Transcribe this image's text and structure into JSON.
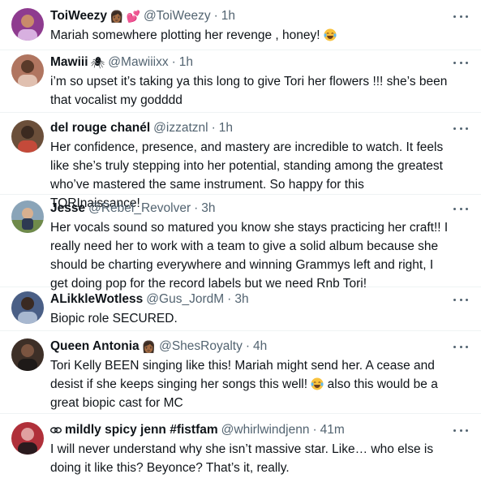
{
  "tweets": [
    {
      "name": "ToiWeezy",
      "emojis": [
        "👩🏾",
        "💕"
      ],
      "handle": "@ToiWeezy",
      "separator": "·",
      "time": "1h",
      "text": "Mariah somewhere plotting her revenge , honey!",
      "avatar_color": "#8e3b8f"
    },
    {
      "name": "Mawiii",
      "emojis": [
        "🕷"
      ],
      "handle": "@Mawiiixx",
      "separator": "·",
      "time": "1h",
      "text": "i’m so upset it’s taking ya this long to give Tori her flowers !!! she’s been that vocalist my godddd",
      "avatar_color": "#b07560"
    },
    {
      "name": "del rouge chanél",
      "handle": "@izzatznl",
      "separator": "·",
      "time": "1h",
      "text": "Her confidence, presence, and mastery are incredible to watch. It feels like she’s truly stepping into her potential, standing among the greatest who’ve mastered the same instrument. So happy for this TORInaissance!",
      "avatar_color": "#6b4f3a"
    },
    {
      "name": "Jesse",
      "handle": "@Rebel_Revolver",
      "separator": "·",
      "time": "3h",
      "text": "Her vocals sound so matured you know she stays practicing her craft!! I really need her to work with a team to give a solid album because she should be charting everywhere and winning Grammys left and right, I get doing pop for the record labels but we need Rnb Tori!",
      "avatar_color": "#8aa4b8"
    },
    {
      "name": "ALikkleWotless",
      "handle": "@Gus_JordM",
      "separator": "·",
      "time": "3h",
      "text": "Biopic role SECURED.",
      "avatar_color": "#4a5f86"
    },
    {
      "name": "Queen Antonia",
      "emojis": [
        "👩🏾"
      ],
      "handle": "@ShesRoyalty",
      "separator": "·",
      "time": "4h",
      "text": "Tori Kelly BEEN singing like this! Mariah might send her. A cease and desist if she keeps singing her songs this well!",
      "text_after": " also this would be a great biopic cast for MC",
      "avatar_color": "#3d2f27"
    },
    {
      "name": "mildly spicy jenn #fistfam",
      "handle": "@whirlwindjenn",
      "separator": "·",
      "time": "41m",
      "text": "I will never understand why she isn’t massive star. Like… who else is doing it like this? Beyonce? That’s it, really.",
      "avatar_color": "#b0303a"
    }
  ]
}
